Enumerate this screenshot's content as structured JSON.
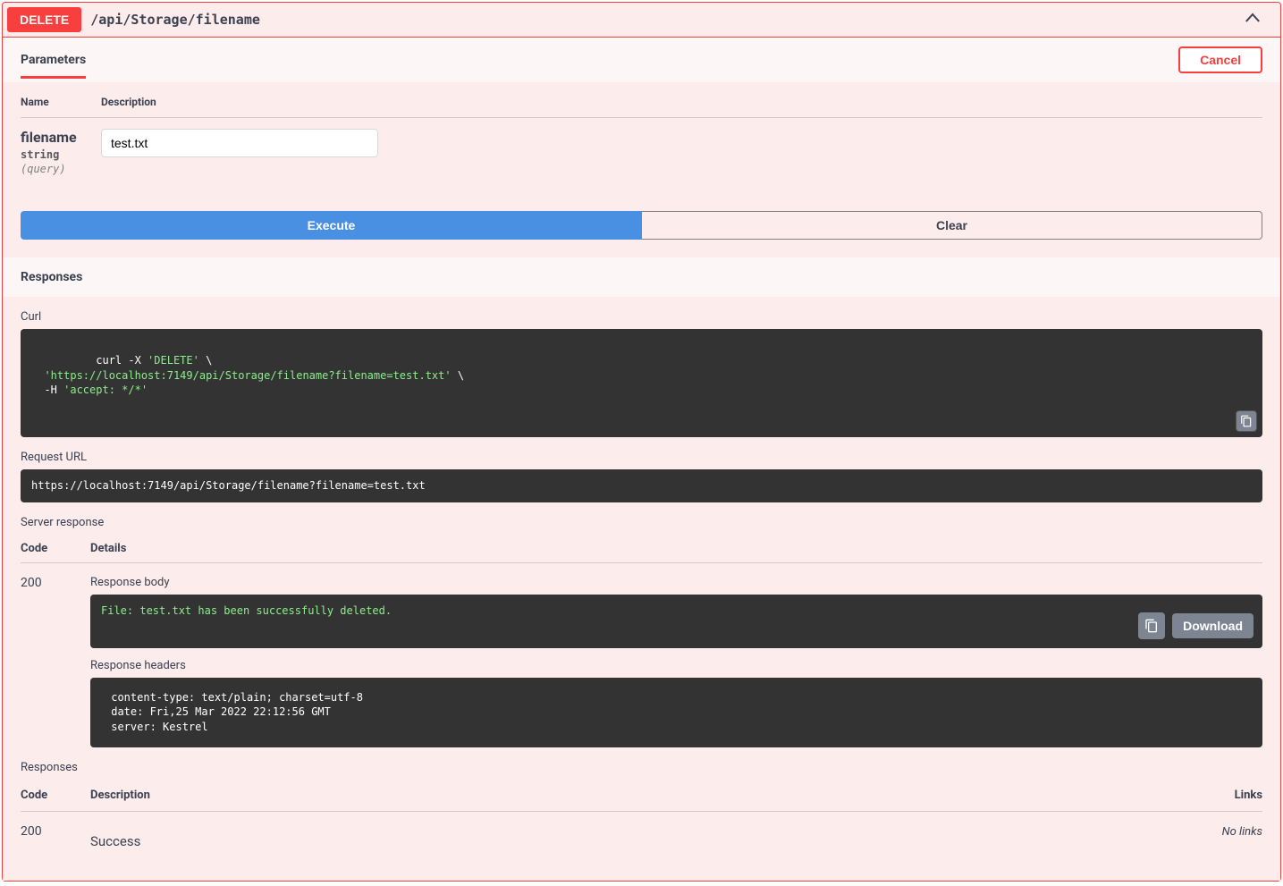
{
  "method": "DELETE",
  "path": "/api/Storage/filename",
  "parameters": {
    "tab_label": "Parameters",
    "cancel_label": "Cancel",
    "headers": {
      "name": "Name",
      "description": "Description"
    },
    "items": [
      {
        "name": "filename",
        "type": "string",
        "in": "(query)",
        "value": "test.txt"
      }
    ]
  },
  "buttons": {
    "execute": "Execute",
    "clear": "Clear",
    "download": "Download"
  },
  "responses": {
    "header_label": "Responses",
    "curl_label": "Curl",
    "curl_html": "<span>curl -X </span><span class='green'>'DELETE'</span><span> \\\n  </span><span class='green'>'https://localhost:7149/api/Storage/filename?filename=test.txt'</span><span> \\\n  -H </span><span class='green'>'accept: */*'</span>",
    "request_url_label": "Request URL",
    "request_url": "https://localhost:7149/api/Storage/filename?filename=test.txt",
    "server_response_label": "Server response",
    "code_label": "Code",
    "details_label": "Details",
    "server": {
      "code": "200",
      "response_body_label": "Response body",
      "response_body": "File: test.txt has been successfully deleted.",
      "response_headers_label": "Response headers",
      "response_headers": " content-type: text/plain; charset=utf-8 \n date: Fri,25 Mar 2022 22:12:56 GMT \n server: Kestrel "
    },
    "list_label": "Responses",
    "description_label": "Description",
    "links_label": "Links",
    "documented": [
      {
        "code": "200",
        "description": "Success",
        "links": "No links"
      }
    ]
  }
}
